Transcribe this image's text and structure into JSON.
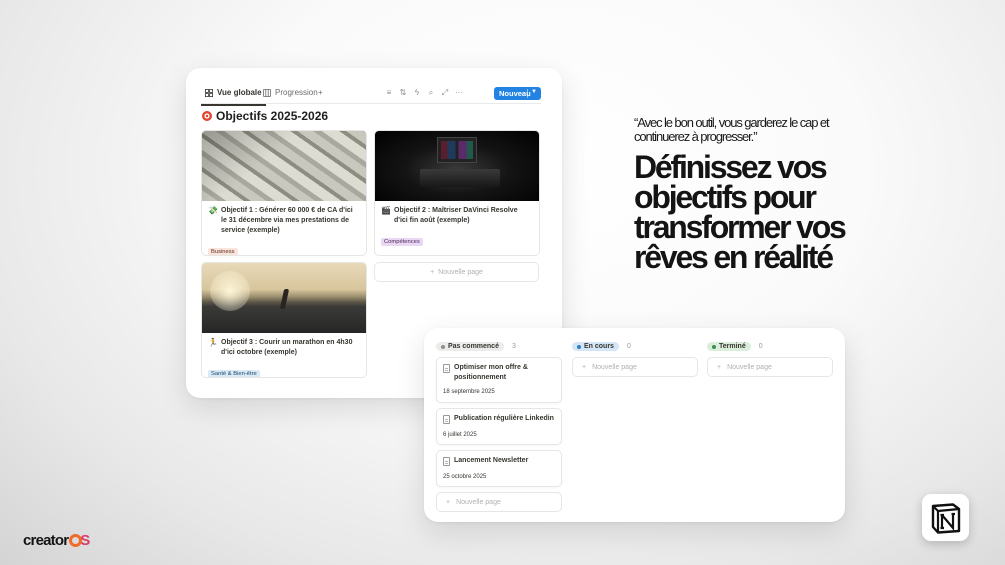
{
  "gallery": {
    "tabs": [
      {
        "label": "Vue globale",
        "icon": "gallery-grid-icon",
        "active": true
      },
      {
        "label": "Progression",
        "icon": "board-columns-icon",
        "active": false
      }
    ],
    "add_tab": "+",
    "toolbar_icons": [
      "filter-icon",
      "sort-icon",
      "automation-bolt-icon",
      "search-icon",
      "expand-icon",
      "more-icon"
    ],
    "new_button": "Nouveau",
    "title": "Objectifs 2025-2026",
    "title_icon": "target-icon",
    "cards": [
      {
        "emoji": "💸",
        "title": "Objectif 1 : Générer 60 000 € de CA d'ici le 31 décembre via mes prestations de service (exemple)",
        "tag": "Business",
        "image": "dollar-bills"
      },
      {
        "emoji": "🎬",
        "title": "Objectif 2 : Maîtriser DaVinci Resolve d'ici fin août (exemple)",
        "tag": "Compétences",
        "image": "editing-desk"
      },
      {
        "emoji": "🏃",
        "title": "Objectif 3 : Courir un marathon en 4h30 d'ici octobre (exemple)",
        "tag": "Santé & Bien-être",
        "image": "runner-desert"
      }
    ],
    "new_page": "Nouvelle page"
  },
  "board": {
    "columns": [
      {
        "label": "Pas commencé",
        "count": "3",
        "color": "gray"
      },
      {
        "label": "En cours",
        "count": "0",
        "color": "blue"
      },
      {
        "label": "Terminé",
        "count": "0",
        "color": "green"
      }
    ],
    "cards": [
      {
        "title": "Optimiser mon offre & positionnement",
        "date": "18 septembre 2025"
      },
      {
        "title": "Publication régulière Linkedin",
        "date": "6 juillet 2025"
      },
      {
        "title": "Lancement Newsletter",
        "date": "25 octobre 2025"
      }
    ],
    "new_page": "Nouvelle page"
  },
  "marketing": {
    "quote": "“Avec le bon outil, vous garderez le cap et continuerez à progresser.”",
    "headline": "Définissez vos objectifs pour transformer vos rêves en réalité"
  },
  "brand": {
    "prefix": "creator",
    "suffix_o": "O",
    "suffix_s": "S"
  },
  "colors": {
    "accent": "#2383e2",
    "brand_orange": "#f06a2a",
    "brand_pink": "#d93a6a"
  }
}
